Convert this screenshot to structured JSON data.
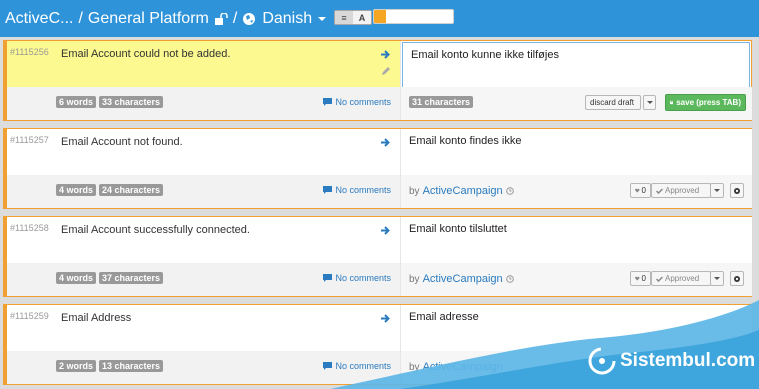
{
  "header": {
    "project": "ActiveC...",
    "separator": "/",
    "resource": "General Platform",
    "language": "Danish",
    "view_toggle": [
      "≡",
      "A"
    ],
    "progress_fraction": 0.15,
    "colors": {
      "bar": "#2e93d9",
      "progress": "#f5a623"
    }
  },
  "rows": [
    {
      "id": "#1115256",
      "source": "Email Account could not be added.",
      "words": "6 words",
      "chars": "33 characters",
      "comments": "No comments",
      "translation": "Email konto kunne ikke tilføjes",
      "target_chars": "31 characters",
      "discard_label": "discard draft",
      "save_label": "save (press TAB)"
    },
    {
      "id": "#1115257",
      "source": "Email Account not found.",
      "words": "4 words",
      "chars": "24 characters",
      "comments": "No comments",
      "translation": "Email konto findes ikke",
      "by": "by",
      "author": "ActiveCampaign",
      "votes": "0",
      "status": "Approved"
    },
    {
      "id": "#1115258",
      "source": "Email Account successfully connected.",
      "words": "4 words",
      "chars": "37 characters",
      "comments": "No comments",
      "translation": "Email konto tilsluttet",
      "by": "by",
      "author": "ActiveCampaign",
      "votes": "0",
      "status": "Approved"
    },
    {
      "id": "#1115259",
      "source": "Email Address",
      "words": "2 words",
      "chars": "13 characters",
      "comments": "No comments",
      "translation": "Email adresse",
      "by": "by",
      "author": "ActiveCampaign"
    }
  ],
  "watermark": {
    "text": "Sistembul.com"
  }
}
